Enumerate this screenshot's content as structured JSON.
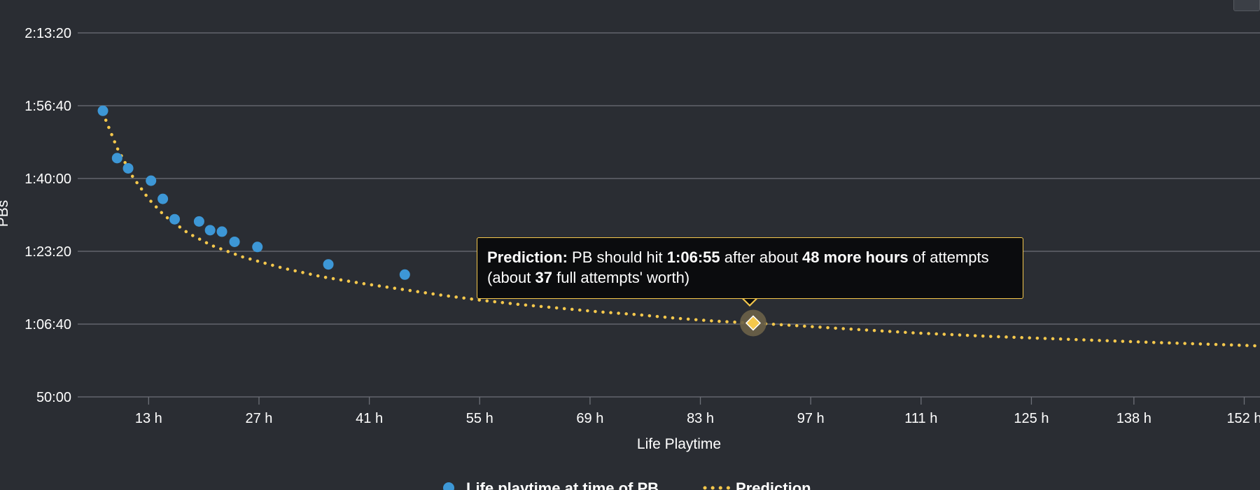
{
  "chart_data": {
    "type": "scatter",
    "title": "",
    "xlabel": "Life Playtime",
    "ylabel": "PBs",
    "x_unit": "hours",
    "y_unit": "seconds",
    "xlim": [
      4,
      154
    ],
    "ylim": [
      3000,
      8000
    ],
    "y_ticks": [
      {
        "value": 8000,
        "label": "2:13:20"
      },
      {
        "value": 7000,
        "label": "1:56:40"
      },
      {
        "value": 6000,
        "label": "1:40:00"
      },
      {
        "value": 5000,
        "label": "1:23:20"
      },
      {
        "value": 4000,
        "label": "1:06:40"
      },
      {
        "value": 3000,
        "label": "50:00"
      }
    ],
    "x_ticks": [
      {
        "value": 13,
        "label": "13 h"
      },
      {
        "value": 27,
        "label": "27 h"
      },
      {
        "value": 41,
        "label": "41 h"
      },
      {
        "value": 55,
        "label": "55 h"
      },
      {
        "value": 69,
        "label": "69 h"
      },
      {
        "value": 83,
        "label": "83 h"
      },
      {
        "value": 97,
        "label": "97 h"
      },
      {
        "value": 111,
        "label": "111 h"
      },
      {
        "value": 125,
        "label": "125 h"
      },
      {
        "value": 138,
        "label": "138 h"
      },
      {
        "value": 152,
        "label": "152 h"
      }
    ],
    "grid": true,
    "legend_position": "bottom",
    "series": [
      {
        "name": "Life playtime at time of PB",
        "type": "scatter",
        "color": "#3d97d6",
        "points": [
          [
            7.2,
            6930
          ],
          [
            9.0,
            6280
          ],
          [
            10.4,
            6140
          ],
          [
            13.3,
            5970
          ],
          [
            14.8,
            5720
          ],
          [
            16.3,
            5440
          ],
          [
            19.4,
            5410
          ],
          [
            20.8,
            5290
          ],
          [
            22.3,
            5270
          ],
          [
            23.9,
            5130
          ],
          [
            26.8,
            5060
          ],
          [
            35.8,
            4820
          ],
          [
            45.5,
            4680
          ]
        ]
      },
      {
        "name": "Prediction",
        "type": "line",
        "style": "dotted",
        "color": "#f5c84c",
        "points": [
          [
            7.2,
            6900
          ],
          [
            9,
            6420
          ],
          [
            11,
            6020
          ],
          [
            13,
            5720
          ],
          [
            15,
            5490
          ],
          [
            18,
            5250
          ],
          [
            21,
            5080
          ],
          [
            25,
            4920
          ],
          [
            30,
            4770
          ],
          [
            35,
            4650
          ],
          [
            40,
            4560
          ],
          [
            45,
            4480
          ],
          [
            50,
            4400
          ],
          [
            55,
            4330
          ],
          [
            60,
            4270
          ],
          [
            65,
            4220
          ],
          [
            70,
            4170
          ],
          [
            75,
            4130
          ],
          [
            80,
            4080
          ],
          [
            85,
            4040
          ],
          [
            89.7,
            4015
          ],
          [
            95,
            3980
          ],
          [
            100,
            3945
          ],
          [
            110,
            3880
          ],
          [
            120,
            3830
          ],
          [
            130,
            3790
          ],
          [
            140,
            3750
          ],
          [
            150,
            3715
          ],
          [
            154,
            3700
          ]
        ]
      }
    ],
    "highlight": {
      "x": 89.7,
      "y": 4015,
      "marker": "diamond",
      "color": "#f5c84c",
      "halo_color": "#6b6248"
    }
  },
  "tooltip": {
    "label": "Prediction:",
    "t1": " PB should hit ",
    "time": "1:06:55",
    "t2": " after about ",
    "hours": "48 more hours",
    "t3": " of attempts",
    "t4": "(about ",
    "count": "37",
    "t5": " full attempts' worth)"
  },
  "colors": {
    "background": "#2a2d33",
    "text": "#ffffff",
    "grid": "#6d7078",
    "pb_points": "#3d97d6",
    "prediction": "#f5c84c"
  }
}
